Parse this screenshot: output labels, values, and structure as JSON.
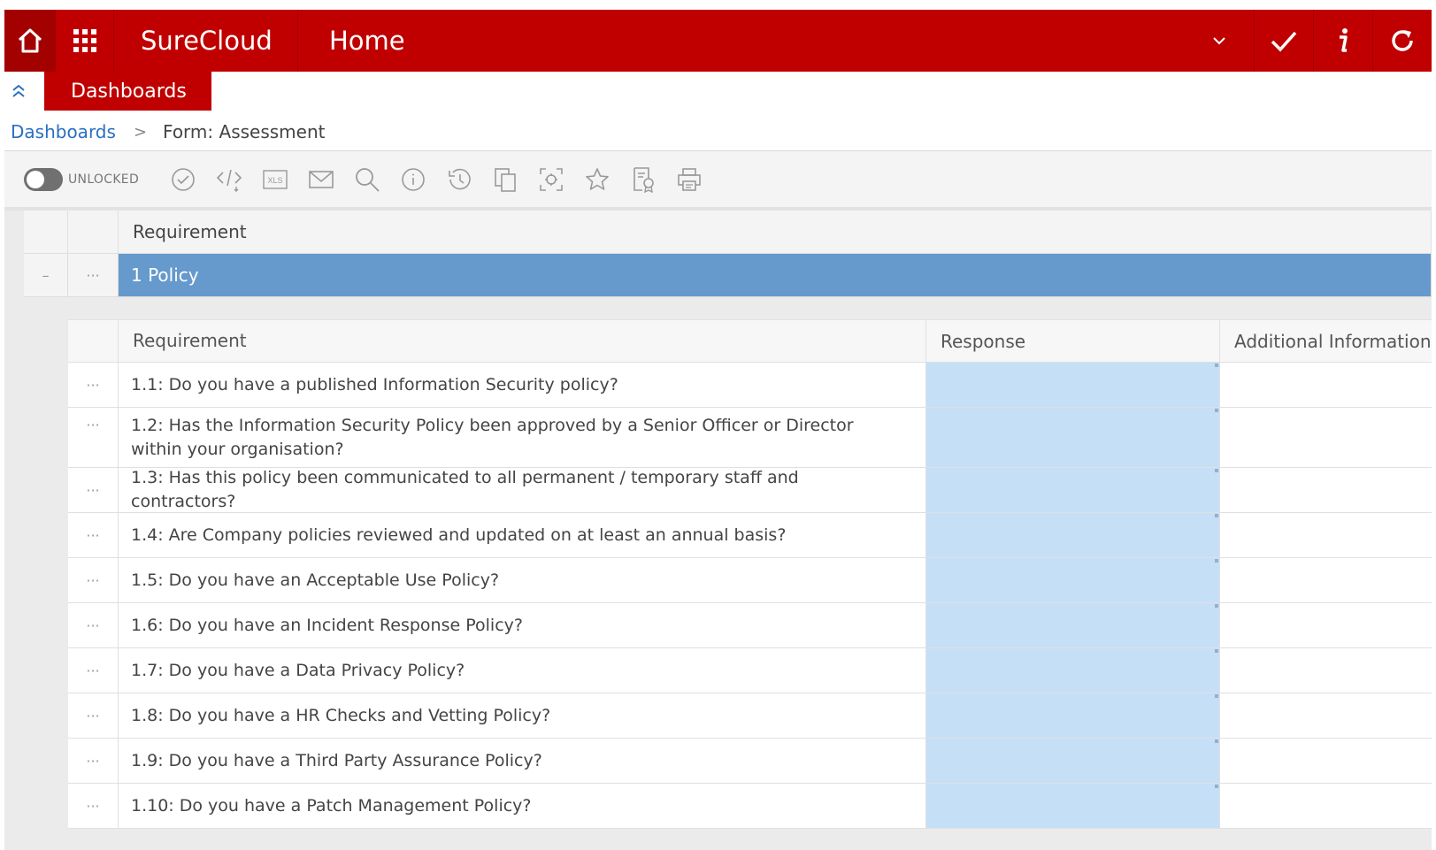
{
  "topbar": {
    "brand": "SureCloud",
    "title": "Home"
  },
  "tab": {
    "label": "Dashboards"
  },
  "breadcrumb": {
    "link": "Dashboards",
    "separator": ">",
    "current": "Form: Assessment"
  },
  "toolbar": {
    "lock_label": "UNLOCKED",
    "tools": [
      "check-circle-icon",
      "code-icon",
      "xls-icon",
      "email-icon",
      "search-icon",
      "info-icon",
      "history-icon",
      "copy-icon",
      "focus-icon",
      "star-icon",
      "certificate-icon",
      "print-icon"
    ]
  },
  "outer": {
    "header": "Requirement",
    "group": {
      "collapse_symbol": "–",
      "dots": "···",
      "label": "1 Policy"
    }
  },
  "inner": {
    "headers": {
      "requirement": "Requirement",
      "response": "Response",
      "additional": "Additional Information"
    },
    "dots": "···",
    "rows": [
      {
        "requirement": "1.1: Do you have a published Information Security policy?",
        "response": "",
        "additional": ""
      },
      {
        "requirement": "1.2: Has the Information Security Policy been approved by a Senior Officer or Director within your organisation?",
        "response": "",
        "additional": ""
      },
      {
        "requirement": "1.3: Has this policy been communicated to all permanent / temporary staff and contractors?",
        "response": "",
        "additional": ""
      },
      {
        "requirement": "1.4: Are Company policies reviewed and updated on at least an annual basis?",
        "response": "",
        "additional": ""
      },
      {
        "requirement": "1.5: Do you have an Acceptable Use Policy?",
        "response": "",
        "additional": ""
      },
      {
        "requirement": "1.6: Do you have an Incident Response Policy?",
        "response": "",
        "additional": ""
      },
      {
        "requirement": "1.7: Do you have a Data Privacy Policy?",
        "response": "",
        "additional": ""
      },
      {
        "requirement": "1.8: Do you have a HR Checks and Vetting Policy?",
        "response": "",
        "additional": ""
      },
      {
        "requirement": "1.9: Do you have a Third Party Assurance Policy?",
        "response": "",
        "additional": ""
      },
      {
        "requirement": "1.10: Do you have a Patch Management Policy?",
        "response": "",
        "additional": ""
      }
    ]
  },
  "colors": {
    "brand_red": "#c00000",
    "group_blue": "#6699cc",
    "response_fill": "#c5dff7"
  }
}
